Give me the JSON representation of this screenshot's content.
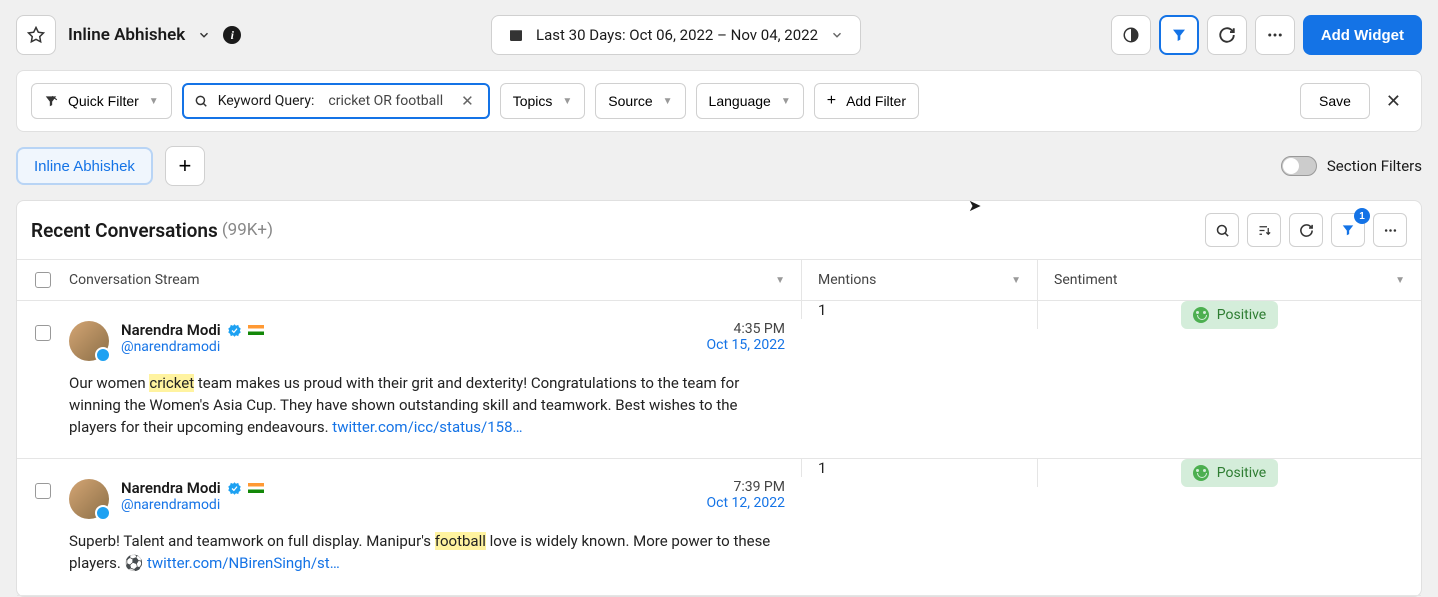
{
  "header": {
    "title": "Inline Abhishek",
    "date_range": "Last 30 Days: Oct 06, 2022 – Nov 04, 2022",
    "add_widget": "Add Widget"
  },
  "filters": {
    "quick_filter": "Quick Filter",
    "keyword_label": "Keyword Query:",
    "keyword_value": "cricket OR football",
    "topics": "Topics",
    "source": "Source",
    "language": "Language",
    "add_filter": "Add Filter",
    "save": "Save"
  },
  "tabs": {
    "active": "Inline Abhishek",
    "section_filters": "Section Filters"
  },
  "panel": {
    "title": "Recent Conversations",
    "count": "(99K+)",
    "filter_badge": "1",
    "columns": {
      "conv": "Conversation Stream",
      "mentions": "Mentions",
      "sentiment": "Sentiment"
    }
  },
  "rows": [
    {
      "author": "Narendra Modi",
      "handle": "@narendramodi",
      "time": "4:35 PM",
      "date": "Oct 15, 2022",
      "text_pre": "Our women ",
      "text_hl": "cricket",
      "text_post": " team makes us proud with their grit and dexterity! Congratulations to the team for winning the Women's Asia Cup. They have shown outstanding skill and teamwork. Best wishes to the players for their upcoming endeavours. ",
      "text_link": "twitter.com/icc/status/158…",
      "mentions": "1",
      "sentiment": "Positive"
    },
    {
      "author": "Narendra Modi",
      "handle": "@narendramodi",
      "time": "7:39 PM",
      "date": "Oct 12, 2022",
      "text_pre": "Superb! Talent and teamwork on full display. Manipur's ",
      "text_hl": "football",
      "text_post": " love is widely known.  More power to these players. ⚽ ",
      "text_link": "twitter.com/NBirenSingh/st…",
      "mentions": "1",
      "sentiment": "Positive"
    }
  ]
}
